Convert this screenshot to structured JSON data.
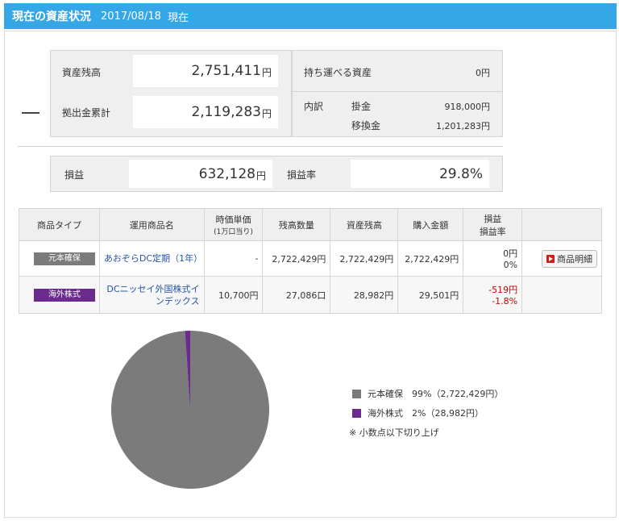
{
  "header": {
    "title": "現在の資産状況",
    "date": "2017/08/18",
    "now_label": "現在"
  },
  "summary": {
    "asset_balance_label": "資産残高",
    "asset_balance_value": "2,751,411",
    "contribution_label": "拠出金累計",
    "contribution_value": "2,119,283",
    "yen": "円",
    "portable_label": "持ち運べる資産",
    "portable_value": "0円",
    "breakdown_label": "内訳",
    "premium_label": "掛金",
    "premium_value": "918,000円",
    "transfer_label": "移換金",
    "transfer_value": "1,201,283円"
  },
  "profit": {
    "profit_label": "損益",
    "profit_value": "632,128",
    "rate_label": "損益率",
    "rate_value": "29.8%"
  },
  "table": {
    "headers": [
      "商品タイプ",
      "運用商品名",
      "時価単価",
      "(1万口当り)",
      "残高数量",
      "資産残高",
      "購入金額",
      "損益",
      "損益率"
    ],
    "rows": [
      {
        "type": "元本確保",
        "name": "あおぞらDC定期（1年）",
        "unit_price": "-",
        "quantity": "2,722,429円",
        "balance": "2,722,429円",
        "purchase": "2,722,429円",
        "profit": "0円",
        "rate": "0%",
        "detail_button": "商品明細"
      },
      {
        "type": "海外株式",
        "name": "DCニッセイ外国株式インデックス",
        "unit_price": "10,700円",
        "quantity": "27,086口",
        "balance": "28,982円",
        "purchase": "29,501円",
        "profit": "-519円",
        "rate": "-1.8%"
      }
    ]
  },
  "legend": {
    "items": [
      {
        "label": "元本確保　99%（2,722,429円）",
        "color": "#7b7b7b"
      },
      {
        "label": "海外株式　2%（28,982円）",
        "color": "#6b2a8e"
      }
    ],
    "note": "※ 小数点以下切り上げ"
  },
  "chart_data": {
    "type": "pie",
    "categories": [
      "元本確保",
      "海外株式"
    ],
    "values": [
      2722429,
      28982
    ],
    "colors": [
      "#7b7b7b",
      "#6b2a8e"
    ]
  }
}
